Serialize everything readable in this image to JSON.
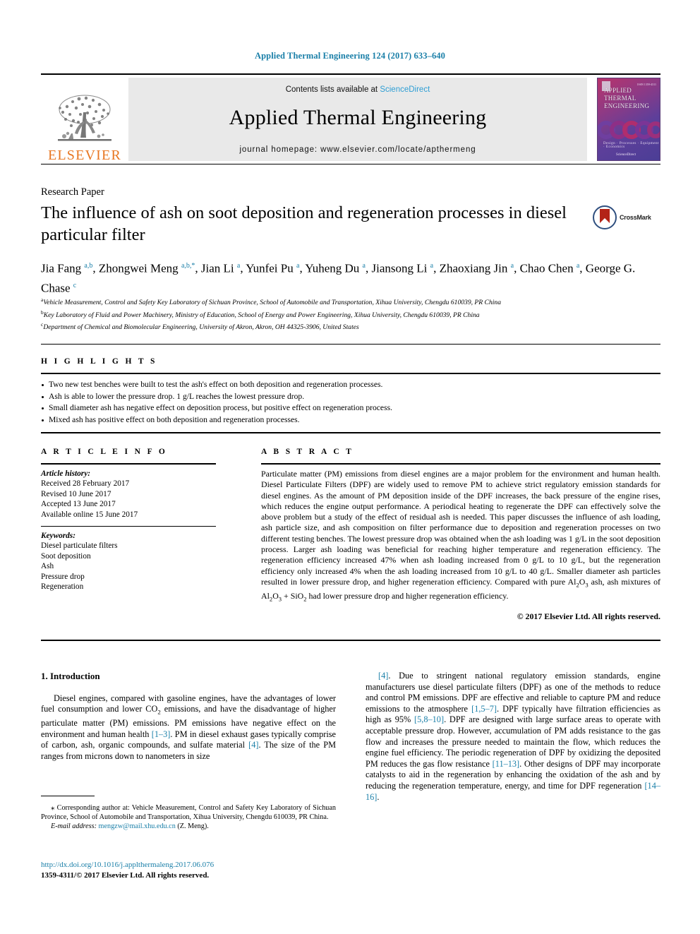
{
  "running_head": "Applied Thermal Engineering 124 (2017) 633–640",
  "masthead": {
    "publisher_logo_text": "ELSEVIER",
    "contents_prefix": "Contents lists available at ",
    "contents_link": "ScienceDirect",
    "journal_name": "Applied Thermal Engineering",
    "homepage": "journal homepage: www.elsevier.com/locate/apthermeng",
    "cover": {
      "line1": "APPLIED",
      "line2": "THERMAL",
      "line3": "ENGINEERING",
      "footer_line": "Design · Processes · Equipment · Economics",
      "bottom_label": "ScienceDirect",
      "topright_label": "ISSN 1359-4311"
    }
  },
  "article": {
    "kicker": "Research Paper",
    "title": "The influence of ash on soot deposition and regeneration processes in diesel particular filter",
    "crossmark_label": "CrossMark",
    "authors_html": "Jia Fang <sup>a,b</sup>, Zhongwei Meng <sup>a,b,</sup><sup>*</sup>, Jian Li <sup>a</sup>, Yunfei Pu <sup>a</sup>, Yuheng Du <sup>a</sup>, Jiansong Li <sup>a</sup>, Zhaoxiang Jin <sup>a</sup>, Chao Chen <sup>a</sup>, George G. Chase <sup>c</sup>",
    "affiliations": [
      "Vehicle Measurement, Control and Safety Key Laboratory of Sichuan Province, School of Automobile and Transportation, Xihua University, Chengdu 610039, PR China",
      "Key Laboratory of Fluid and Power Machinery, Ministry of Education, School of Energy and Power Engineering, Xihua University, Chengdu 610039, PR China",
      "Department of Chemical and Biomolecular Engineering, University of Akron, Akron, OH 44325-3906, United States"
    ],
    "affiliation_marks": [
      "a",
      "b",
      "c"
    ]
  },
  "highlights": {
    "heading": "H I G H L I G H T S",
    "items": [
      "Two new test benches were built to test the ash's effect on both deposition and regeneration processes.",
      "Ash is able to lower the pressure drop. 1 g/L reaches the lowest pressure drop.",
      "Small diameter ash has negative effect on deposition process, but positive effect on regeneration process.",
      "Mixed ash has positive effect on both deposition and regeneration processes."
    ]
  },
  "article_info": {
    "heading": "A R T I C L E   I N F O",
    "history_label": "Article history:",
    "history": [
      "Received 28 February 2017",
      "Revised 10 June 2017",
      "Accepted 13 June 2017",
      "Available online 15 June 2017"
    ],
    "keywords_label": "Keywords:",
    "keywords": [
      "Diesel particulate filters",
      "Soot deposition",
      "Ash",
      "Pressure drop",
      "Regeneration"
    ]
  },
  "abstract": {
    "heading": "A B S T R A C T",
    "text_html": "Particulate matter (PM) emissions from diesel engines are a major problem for the environment and human health. Diesel Particulate Filters (DPF) are widely used to remove PM to achieve strict regulatory emission standards for diesel engines. As the amount of PM deposition inside of the DPF increases, the back pressure of the engine rises, which reduces the engine output performance. A periodical heating to regenerate the DPF can effectively solve the above problem but a study of the effect of residual ash is needed. This paper discusses the influence of ash loading, ash particle size, and ash composition on filter performance due to deposition and regeneration processes on two different testing benches. The lowest pressure drop was obtained when the ash loading was 1 g/L in the soot deposition process. Larger ash loading was beneficial for reaching higher temperature and regeneration efficiency. The regeneration efficiency increased 47% when ash loading increased from 0 g/L to 10 g/L, but the regeneration efficiency only increased 4% when the ash loading increased from 10 g/L to 40 g/L. Smaller diameter ash particles resulted in lower pressure drop, and higher regeneration efficiency. Compared with pure Al<sub>2</sub>O<sub>3</sub> ash, ash mixtures of Al<sub>2</sub>O<sub>3</sub> + SiO<sub>2</sub> had lower pressure drop and higher regeneration efficiency.",
    "copyright": "© 2017 Elsevier Ltd. All rights reserved."
  },
  "body": {
    "section_heading": "1. Introduction",
    "left_paragraph_html": "Diesel engines, compared with gasoline engines, have the advantages of lower fuel consumption and lower CO<sub>2</sub> emissions, and have the disadvantage of higher particulate matter (PM) emissions. PM emissions have negative effect on the environment and human health <span class=\"ref\">[1–3]</span>. PM in diesel exhaust gases typically comprise of carbon, ash, organic compounds, and sulfate material <span class=\"ref\">[4]</span>. The size of the PM ranges from microns down to nanometers in size",
    "right_paragraph_html": "<span class=\"ref\">[4]</span>. Due to stringent national regulatory emission standards, engine manufacturers use diesel particulate filters (DPF) as one of the methods to reduce and control PM emissions. DPF are effective and reliable to capture PM and reduce emissions to the atmosphere <span class=\"ref\">[1,5–7]</span>. DPF typically have filtration efficiencies as high as 95% <span class=\"ref\">[5,8–10]</span>. DPF are designed with large surface areas to operate with acceptable pressure drop. However, accumulation of PM adds resistance to the gas flow and increases the pressure needed to maintain the flow, which reduces the engine fuel efficiency. The periodic regeneration of DPF by oxidizing the deposited PM reduces the gas flow resistance <span class=\"ref\">[11–13]</span>. Other designs of DPF may incorporate catalysts to aid in the regeneration by enhancing the oxidation of the ash and by reducing the regeneration temperature, energy, and time for DPF regeneration <span class=\"ref\">[14–16]</span>."
  },
  "footnote": {
    "corresponding_html": "<span style=\"font-size:11px\">⁎</span> Corresponding author at: Vehicle Measurement, Control and Safety Key Laboratory of Sichuan Province, School of Automobile and Transportation, Xihua University, Chengdu 610039, PR China.",
    "email_label": "E-mail address:",
    "email": "mengzw@mail.xhu.edu.cn",
    "email_suffix": "(Z. Meng)."
  },
  "footer": {
    "doi": "http://dx.doi.org/10.1016/j.applthermaleng.2017.06.076",
    "issn_line": "1359-4311/© 2017 Elsevier Ltd. All rights reserved."
  },
  "colors": {
    "link_blue": "#1a7fa8",
    "sciencedirect_blue": "#2e9ed4",
    "elsevier_orange": "#E87722",
    "crossmark_red": "#b32317"
  }
}
